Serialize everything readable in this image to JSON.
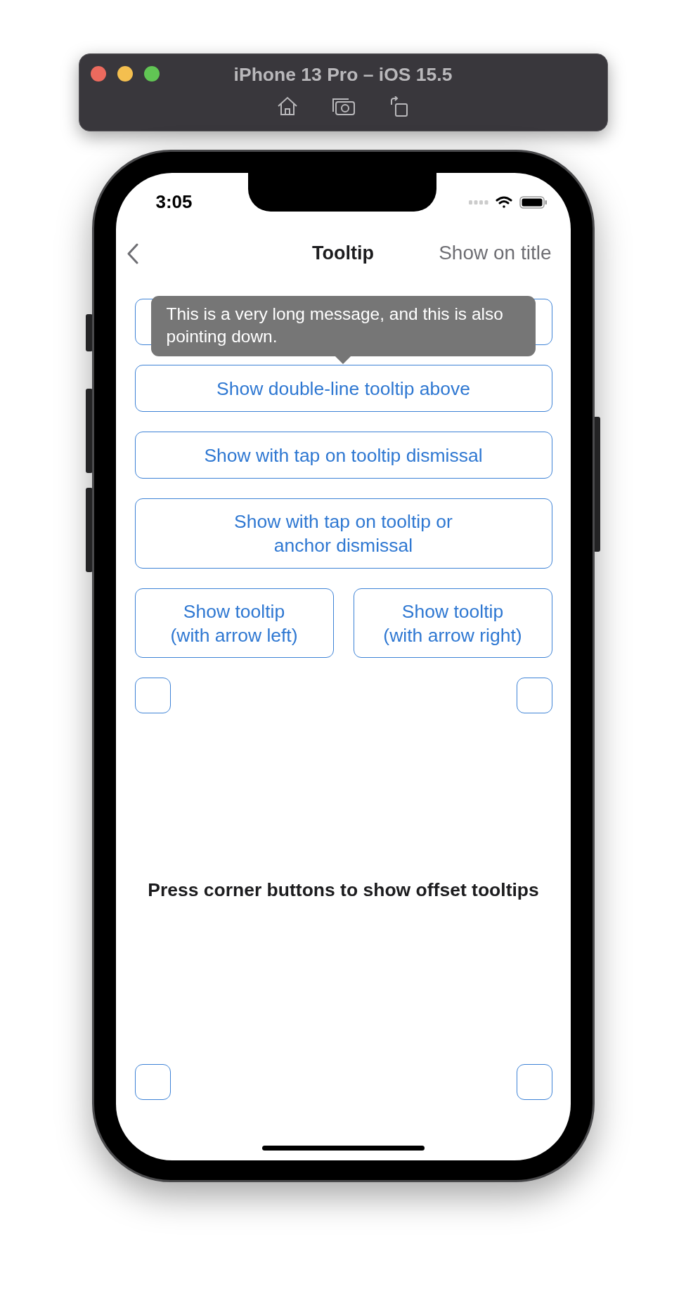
{
  "simulator": {
    "title": "iPhone 13 Pro – iOS 15.5"
  },
  "status_bar": {
    "time": "3:05"
  },
  "nav_bar": {
    "title": "Tooltip",
    "action": "Show on title"
  },
  "tooltip": {
    "text": "This is a very long message, and this is also pointing down."
  },
  "button_rows": [
    [
      {
        "kind": "blank"
      }
    ],
    [
      {
        "kind": "text",
        "label": "Show double-line tooltip above"
      }
    ],
    [
      {
        "kind": "text",
        "label": "Show with tap on tooltip dismissal"
      }
    ],
    [
      {
        "kind": "text",
        "label": "Show with tap on tooltip or\nanchor dismissal"
      }
    ],
    [
      {
        "kind": "text",
        "label": "Show tooltip\n(with arrow left)"
      },
      {
        "kind": "text",
        "label": "Show tooltip\n(with arrow right)"
      }
    ]
  ],
  "caption": "Press corner buttons to show offset tooltips"
}
